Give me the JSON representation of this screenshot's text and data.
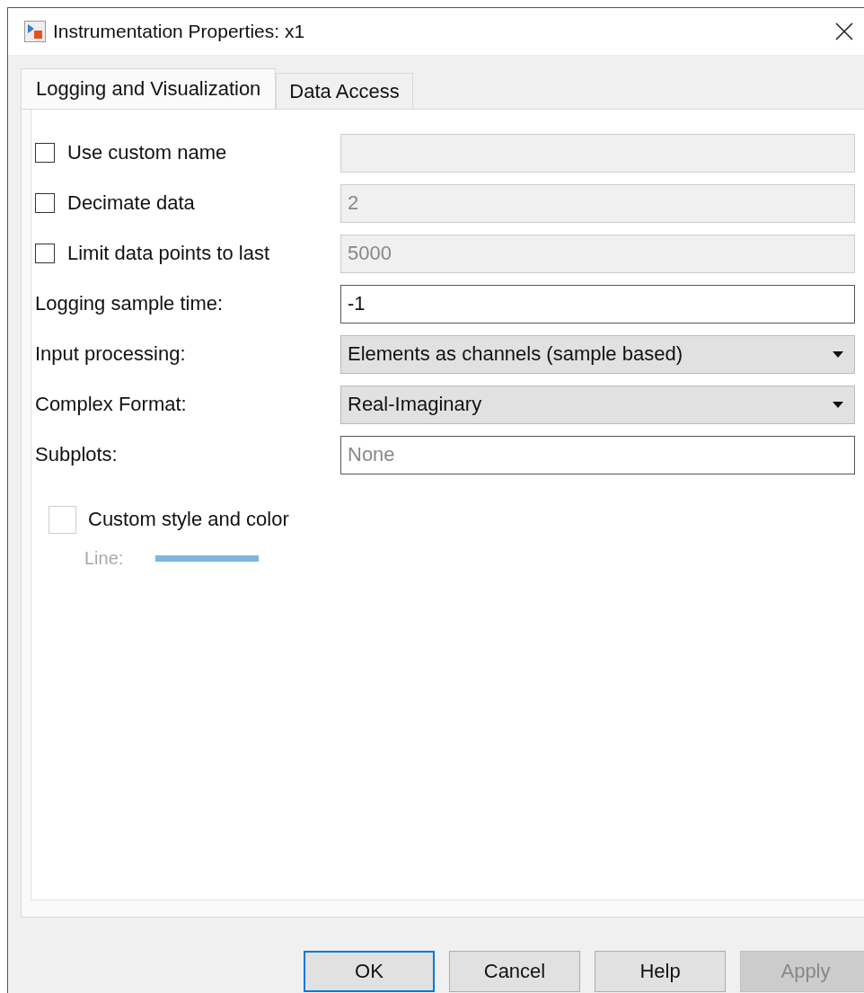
{
  "window": {
    "title": "Instrumentation Properties: x1"
  },
  "tabs": [
    {
      "label": "Logging and Visualization",
      "selected": true
    },
    {
      "label": "Data Access",
      "selected": false
    }
  ],
  "rows": [
    {
      "kind": "checkbox",
      "label": "Use custom name",
      "checked": false,
      "field": {
        "disabled": true
      }
    },
    {
      "kind": "checkbox",
      "label": "Decimate data",
      "checked": false,
      "field": {
        "value": "2",
        "disabled": true
      }
    },
    {
      "kind": "checkbox",
      "label": "Limit data points to last",
      "checked": false,
      "field": {
        "value": "5000",
        "disabled": true
      }
    },
    {
      "kind": "text",
      "label": "Logging sample time:",
      "field": {
        "value": "-1",
        "disabled": false
      }
    },
    {
      "kind": "dropdown",
      "label": "Input processing:",
      "field": {
        "value": "Elements as channels (sample based)"
      }
    },
    {
      "kind": "dropdown",
      "label": "Complex Format:",
      "field": {
        "value": "Real-Imaginary"
      }
    },
    {
      "kind": "text",
      "label": "Subplots:",
      "field": {
        "placeholder": "None",
        "disabled": false
      }
    }
  ],
  "custom_style": {
    "label": "Custom style and color",
    "checked": false,
    "disabled": true,
    "line_label": "Line:"
  },
  "buttons": [
    {
      "label": "OK",
      "default": true,
      "disabled": false
    },
    {
      "label": "Cancel",
      "default": false,
      "disabled": false
    },
    {
      "label": "Help",
      "default": false,
      "disabled": false
    },
    {
      "label": "Apply",
      "default": false,
      "disabled": true
    }
  ]
}
